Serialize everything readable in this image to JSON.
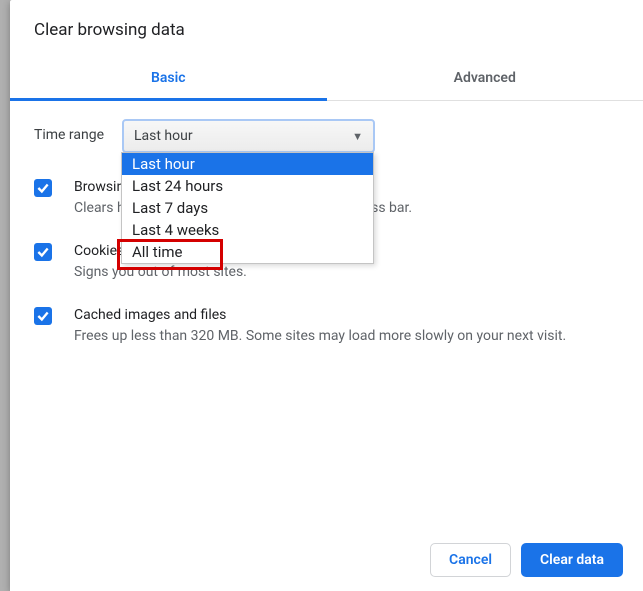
{
  "dialog": {
    "title": "Clear browsing data",
    "tabs": {
      "basic": "Basic",
      "advanced": "Advanced"
    }
  },
  "timeRange": {
    "label": "Time range",
    "selected": "Last hour",
    "options": [
      "Last hour",
      "Last 24 hours",
      "Last 7 days",
      "Last 4 weeks",
      "All time"
    ]
  },
  "checks": {
    "browsing": {
      "title": "Browsing history",
      "desc": "Clears history and autocompletions in the address bar."
    },
    "cookies": {
      "title": "Cookies and other site data",
      "desc": "Signs you out of most sites."
    },
    "cache": {
      "title": "Cached images and files",
      "desc": "Frees up less than 320 MB. Some sites may load more slowly on your next visit."
    }
  },
  "footer": {
    "cancel": "Cancel",
    "clear": "Clear data"
  },
  "colors": {
    "accent": "#1a73e8",
    "highlight": "#d40000"
  }
}
